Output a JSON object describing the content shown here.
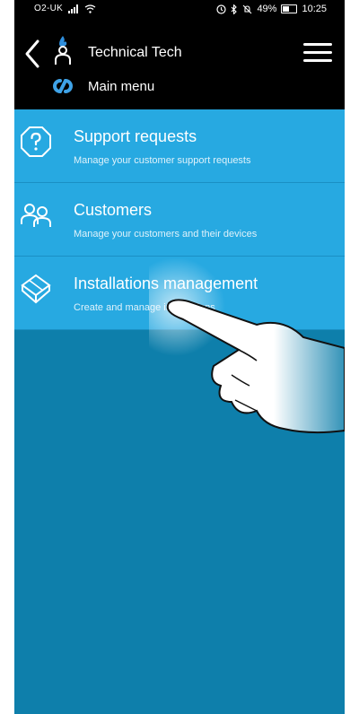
{
  "status_bar": {
    "carrier": "O2-UK",
    "battery": "49%",
    "time": "10:25"
  },
  "header": {
    "technician_name": "Technical Tech",
    "subtitle": "Main menu"
  },
  "menu": {
    "items": [
      {
        "title": "Support requests",
        "description": "Manage your customer support requests",
        "icon": "question-icon"
      },
      {
        "title": "Customers",
        "description": "Manage your customers and their devices",
        "icon": "people-icon"
      },
      {
        "title": "Installations management",
        "description": "Create and manage installations",
        "icon": "cube-icon"
      }
    ]
  },
  "colors": {
    "header_bg": "#000000",
    "menu_item_bg": "#27a9e1",
    "body_bg": "#0e7fab",
    "accent": "#2f8fdd"
  }
}
